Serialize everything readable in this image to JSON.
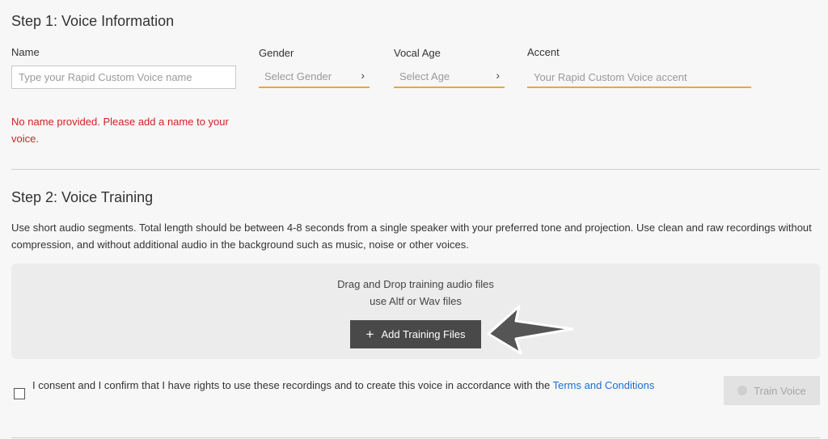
{
  "step1": {
    "title": "Step 1: Voice Information",
    "name_label": "Name",
    "name_placeholder": "Type your Rapid Custom Voice name",
    "gender_label": "Gender",
    "gender_placeholder": "Select Gender",
    "vocal_age_label": "Vocal Age",
    "vocal_age_placeholder": "Select Age",
    "accent_label": "Accent",
    "accent_placeholder": "Your Rapid Custom Voice accent",
    "error_message": "No name provided. Please add a name to your voice."
  },
  "step2": {
    "title": "Step 2: Voice Training",
    "description": "Use short audio segments. Total length should be between 4-8 seconds from a single speaker with your preferred tone and projection. Use clean and raw recordings without compression, and without additional audio in the background such as music, noise or other voices.",
    "dropzone_line1": "Drag and Drop training audio files",
    "dropzone_line2": "use Altf or Wav files",
    "add_button_label": "Add Training Files",
    "consent_text": "I consent and I confirm that I have rights to use these recordings and to create this voice in accordance with the ",
    "terms_link": "Terms and Conditions",
    "train_button_label": "Train Voice"
  },
  "icons": {
    "chevron": "chevron-right-icon",
    "plus": "plus-icon",
    "arrow": "arrow-left-icon",
    "mic": "microphone-icon"
  },
  "colors": {
    "accent_underline": "#f0a532",
    "error": "#d32121",
    "link": "#1a6fd1",
    "primary_button": "#494949",
    "disabled_button": "#e2e2e2"
  }
}
